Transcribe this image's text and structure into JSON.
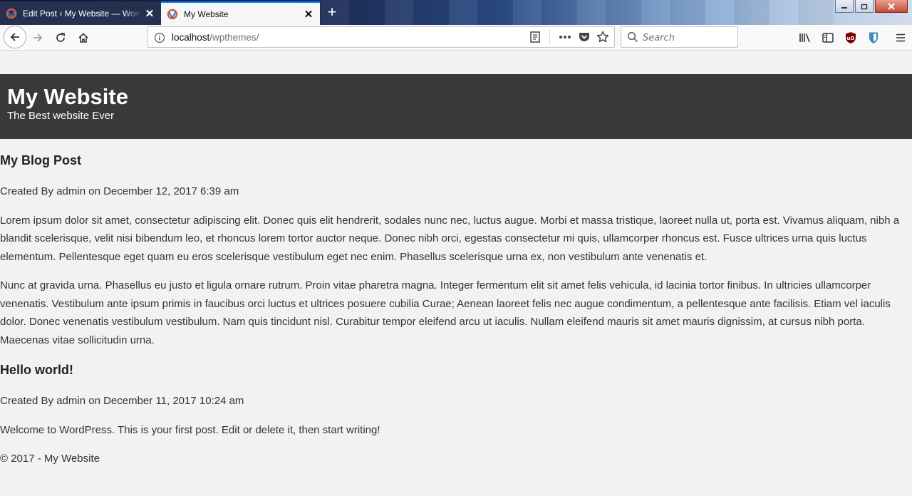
{
  "browser": {
    "tabs": [
      {
        "label": "Edit Post ‹ My Website — WordPress",
        "close": "✕"
      },
      {
        "label": "My Website",
        "close": "✕"
      }
    ],
    "new_tab": "+",
    "url_host": "localhost",
    "url_path": "/wpthemes/",
    "search_placeholder": "Search",
    "accent_color": "#0a84ff"
  },
  "site": {
    "title": "My Website",
    "tagline": "The Best website Ever",
    "header_bg": "#393939"
  },
  "posts": [
    {
      "title": "My Blog Post",
      "meta": "Created By admin on December 12, 2017 6:39 am",
      "paragraphs": [
        "Lorem ipsum dolor sit amet, consectetur adipiscing elit. Donec quis elit hendrerit, sodales nunc nec, luctus augue. Morbi et massa tristique, laoreet nulla ut, porta est. Vivamus aliquam, nibh a blandit scelerisque, velit nisi bibendum leo, et rhoncus lorem tortor auctor neque. Donec nibh orci, egestas consectetur mi quis, ullamcorper rhoncus est. Fusce ultrices urna quis luctus elementum. Pellentesque eget quam eu eros scelerisque vestibulum eget nec enim. Phasellus scelerisque urna ex, non vestibulum ante venenatis et.",
        "Nunc at gravida urna. Phasellus eu justo et ligula ornare rutrum. Proin vitae pharetra magna. Integer fermentum elit sit amet felis vehicula, id lacinia tortor finibus. In ultricies ullamcorper venenatis. Vestibulum ante ipsum primis in faucibus orci luctus et ultrices posuere cubilia Curae; Aenean laoreet felis nec augue condimentum, a pellentesque ante facilisis. Etiam vel iaculis dolor. Donec venenatis vestibulum vestibulum. Nam quis tincidunt nisl. Curabitur tempor eleifend arcu ut iaculis. Nullam eleifend mauris sit amet mauris dignissim, at cursus nibh porta. Maecenas vitae sollicitudin urna."
      ]
    },
    {
      "title": "Hello world!",
      "meta": "Created By admin on December 11, 2017 10:24 am",
      "paragraphs": [
        "Welcome to WordPress. This is your first post. Edit or delete it, then start writing!"
      ]
    }
  ],
  "footer": {
    "text": "© 2017 - My Website"
  }
}
